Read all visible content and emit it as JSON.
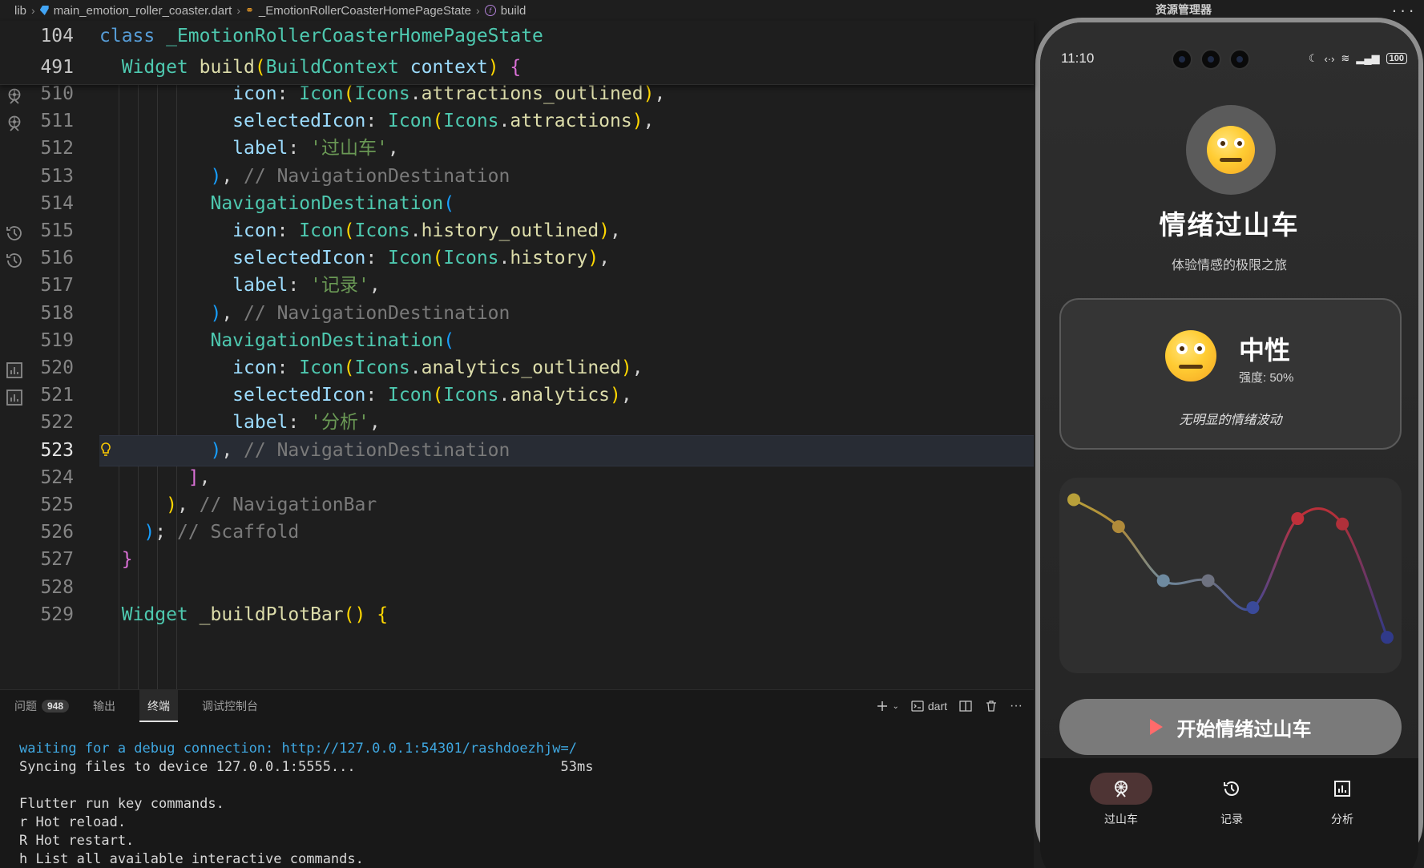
{
  "breadcrumb": {
    "items": [
      "lib",
      "main_emotion_roller_coaster.dart",
      "_EmotionRollerCoasterHomePageState",
      "build"
    ]
  },
  "sticky": [
    {
      "ln": "104",
      "tokens": [
        [
          "k-class",
          "class "
        ],
        [
          "k-type",
          "_EmotionRollerCoasterHomePageState"
        ]
      ]
    },
    {
      "ln": "491",
      "tokens": [
        [
          "k-type",
          "  Widget "
        ],
        [
          "k-fn",
          "build"
        ],
        [
          "b1",
          "("
        ],
        [
          "k-type",
          "BuildContext "
        ],
        [
          "k-param",
          "context"
        ],
        [
          "b1",
          ")"
        ],
        [
          "punc",
          " "
        ],
        [
          "b2",
          "{"
        ]
      ]
    }
  ],
  "code_lines": [
    {
      "ln": "510",
      "icon": "attractions-gutter-icon",
      "tokens": [
        [
          "k-param",
          "            icon"
        ],
        [
          "punc",
          ": "
        ],
        [
          "k-type",
          "Icon"
        ],
        [
          "b1",
          "("
        ],
        [
          "k-type",
          "Icons"
        ],
        [
          "punc",
          "."
        ],
        [
          "prop",
          "attractions_outlined"
        ],
        [
          "b1",
          ")"
        ],
        [
          "punc",
          ","
        ]
      ]
    },
    {
      "ln": "511",
      "icon": "attractions-gutter-icon",
      "tokens": [
        [
          "k-param",
          "            selectedIcon"
        ],
        [
          "punc",
          ": "
        ],
        [
          "k-type",
          "Icon"
        ],
        [
          "b1",
          "("
        ],
        [
          "k-type",
          "Icons"
        ],
        [
          "punc",
          "."
        ],
        [
          "prop",
          "attractions"
        ],
        [
          "b1",
          ")"
        ],
        [
          "punc",
          ","
        ]
      ]
    },
    {
      "ln": "512",
      "tokens": [
        [
          "k-param",
          "            label"
        ],
        [
          "punc",
          ": "
        ],
        [
          "k-str-cn",
          "'过山车'"
        ],
        [
          "punc",
          ","
        ]
      ]
    },
    {
      "ln": "513",
      "tokens": [
        [
          "b3",
          "          )"
        ],
        [
          "punc",
          ", "
        ],
        [
          "k-cm",
          "// NavigationDestination"
        ]
      ]
    },
    {
      "ln": "514",
      "tokens": [
        [
          "k-wid",
          "          NavigationDestination"
        ],
        [
          "b3",
          "("
        ]
      ]
    },
    {
      "ln": "515",
      "icon": "history-gutter-icon",
      "tokens": [
        [
          "k-param",
          "            icon"
        ],
        [
          "punc",
          ": "
        ],
        [
          "k-type",
          "Icon"
        ],
        [
          "b1",
          "("
        ],
        [
          "k-type",
          "Icons"
        ],
        [
          "punc",
          "."
        ],
        [
          "prop",
          "history_outlined"
        ],
        [
          "b1",
          ")"
        ],
        [
          "punc",
          ","
        ]
      ]
    },
    {
      "ln": "516",
      "icon": "history-gutter-icon",
      "tokens": [
        [
          "k-param",
          "            selectedIcon"
        ],
        [
          "punc",
          ": "
        ],
        [
          "k-type",
          "Icon"
        ],
        [
          "b1",
          "("
        ],
        [
          "k-type",
          "Icons"
        ],
        [
          "punc",
          "."
        ],
        [
          "prop",
          "history"
        ],
        [
          "b1",
          ")"
        ],
        [
          "punc",
          ","
        ]
      ]
    },
    {
      "ln": "517",
      "tokens": [
        [
          "k-param",
          "            label"
        ],
        [
          "punc",
          ": "
        ],
        [
          "k-str-cn",
          "'记录'"
        ],
        [
          "punc",
          ","
        ]
      ]
    },
    {
      "ln": "518",
      "tokens": [
        [
          "b3",
          "          )"
        ],
        [
          "punc",
          ", "
        ],
        [
          "k-cm",
          "// NavigationDestination"
        ]
      ]
    },
    {
      "ln": "519",
      "tokens": [
        [
          "k-wid",
          "          NavigationDestination"
        ],
        [
          "b3",
          "("
        ]
      ]
    },
    {
      "ln": "520",
      "icon": "analytics-gutter-icon",
      "tokens": [
        [
          "k-param",
          "            icon"
        ],
        [
          "punc",
          ": "
        ],
        [
          "k-type",
          "Icon"
        ],
        [
          "b1",
          "("
        ],
        [
          "k-type",
          "Icons"
        ],
        [
          "punc",
          "."
        ],
        [
          "prop",
          "analytics_outlined"
        ],
        [
          "b1",
          ")"
        ],
        [
          "punc",
          ","
        ]
      ]
    },
    {
      "ln": "521",
      "icon": "analytics-gutter-icon",
      "tokens": [
        [
          "k-param",
          "            selectedIcon"
        ],
        [
          "punc",
          ": "
        ],
        [
          "k-type",
          "Icon"
        ],
        [
          "b1",
          "("
        ],
        [
          "k-type",
          "Icons"
        ],
        [
          "punc",
          "."
        ],
        [
          "prop",
          "analytics"
        ],
        [
          "b1",
          ")"
        ],
        [
          "punc",
          ","
        ]
      ]
    },
    {
      "ln": "522",
      "tokens": [
        [
          "k-param",
          "            label"
        ],
        [
          "punc",
          ": "
        ],
        [
          "k-str-cn",
          "'分析'"
        ],
        [
          "punc",
          ","
        ]
      ]
    },
    {
      "ln": "523",
      "current": true,
      "bulb": true,
      "tokens": [
        [
          "b3",
          "          )"
        ],
        [
          "punc",
          ", "
        ],
        [
          "k-cm",
          "// NavigationDestination"
        ]
      ]
    },
    {
      "ln": "524",
      "tokens": [
        [
          "b2",
          "        ]"
        ],
        [
          "punc",
          ","
        ]
      ]
    },
    {
      "ln": "525",
      "tokens": [
        [
          "b1",
          "      )"
        ],
        [
          "punc",
          ", "
        ],
        [
          "k-cm",
          "// NavigationBar"
        ]
      ]
    },
    {
      "ln": "526",
      "tokens": [
        [
          "b3",
          "    )"
        ],
        [
          "punc",
          "; "
        ],
        [
          "k-cm",
          "// Scaffold"
        ]
      ]
    },
    {
      "ln": "527",
      "tokens": [
        [
          "b2",
          "  }"
        ]
      ]
    },
    {
      "ln": "528",
      "tokens": []
    },
    {
      "ln": "529",
      "tokens": [
        [
          "k-type",
          "  Widget "
        ],
        [
          "k-fn",
          "_buildPlotBar"
        ],
        [
          "b1",
          "()"
        ],
        [
          "punc",
          " "
        ],
        [
          "b1",
          "{"
        ]
      ]
    }
  ],
  "panel": {
    "tabs": [
      {
        "label": "问题",
        "badge": "948"
      },
      {
        "label": "输出"
      },
      {
        "label": "终端",
        "active": true
      },
      {
        "label": "调试控制台"
      }
    ],
    "shell_label": "dart",
    "terminal": [
      {
        "cls": "t-link",
        "text": "waiting for a debug connection: http://127.0.0.1:54301/rashdoezhjw=/"
      },
      {
        "text": "Syncing files to device 127.0.0.1:5555...                         53ms"
      },
      {
        "text": ""
      },
      {
        "text": "Flutter run key commands."
      },
      {
        "text": "r Hot reload."
      },
      {
        "text": "R Hot restart."
      },
      {
        "text": "h List all available interactive commands."
      }
    ]
  },
  "window": {
    "title": "资源管理器",
    "more": "..."
  },
  "phone": {
    "time": "11:10",
    "battery": "100",
    "app_title": "情绪过山车",
    "app_subtitle": "体验情感的极限之旅",
    "emotion": {
      "name": "中性",
      "intensity": "强度: 50%",
      "description": "无明显的情绪波动"
    },
    "start_button": "开始情绪过山车",
    "nav": [
      {
        "label": "过山车",
        "icon": "attractions-icon",
        "active": true
      },
      {
        "label": "记录",
        "icon": "history-icon"
      },
      {
        "label": "分析",
        "icon": "analytics-icon"
      }
    ]
  },
  "chart_data": {
    "type": "line",
    "title": "",
    "xlabel": "",
    "ylabel": "",
    "x": [
      0,
      1,
      2,
      3,
      4,
      5,
      6,
      7
    ],
    "series": [
      {
        "values": [
          0.92,
          0.72,
          0.32,
          0.32,
          0.12,
          0.78,
          0.74,
          -0.1
        ]
      }
    ],
    "point_colors": [
      "#b8a03a",
      "#b08a3a",
      "#6e8aa0",
      "#6e7280",
      "#3a4a9a",
      "#c0303a",
      "#b0303a",
      "#303a8a"
    ],
    "ylim": [
      -0.2,
      1.0
    ],
    "grid": false
  }
}
